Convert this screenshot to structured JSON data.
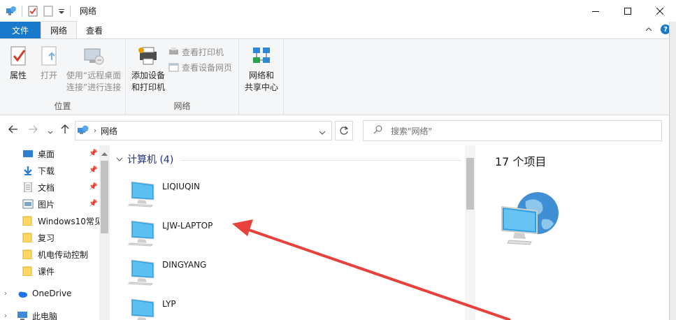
{
  "window": {
    "title": "网络"
  },
  "tabs": [
    {
      "label": "文件"
    },
    {
      "label": "网络"
    },
    {
      "label": "查看"
    }
  ],
  "ribbon": {
    "location_group": {
      "label": "位置",
      "properties": "属性",
      "open": "打开",
      "rdp_line1": "使用“远程桌面",
      "rdp_line2": "连接”进行连接"
    },
    "network_group": {
      "label": "网络",
      "add_device_line1": "添加设备",
      "add_device_line2": "和打印机",
      "view_printers": "查看打印机",
      "view_device_page": "查看设备网页"
    },
    "sharing_group": {
      "line1": "网络和",
      "line2": "共享中心"
    }
  },
  "address": {
    "path": "网络",
    "search_placeholder": "搜索\"网络\""
  },
  "navpane": {
    "items": [
      {
        "label": "桌面"
      },
      {
        "label": "下载"
      },
      {
        "label": "文档"
      },
      {
        "label": "图片"
      },
      {
        "label": "Windows10常见"
      },
      {
        "label": "复习"
      },
      {
        "label": "机电传动控制"
      },
      {
        "label": "课件"
      },
      {
        "label": "OneDrive"
      },
      {
        "label": "此电脑"
      }
    ]
  },
  "content": {
    "group_header": "计算机 (4)",
    "computers": [
      {
        "name": "LIQIUQIN"
      },
      {
        "name": "LJW-LAPTOP"
      },
      {
        "name": "DINGYANG"
      },
      {
        "name": "LYP"
      }
    ]
  },
  "details": {
    "count": "17 个项目"
  },
  "colors": {
    "accent": "#1979ca",
    "group_header": "#1e3287",
    "annotation": "#e8403a"
  }
}
